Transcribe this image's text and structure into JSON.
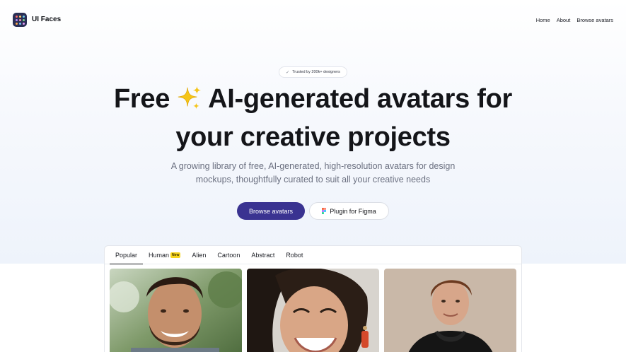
{
  "brand": {
    "name": "UI Faces",
    "logo_dot_colors": [
      "#ff6b6b",
      "#ffd166",
      "#6bcBef",
      "#b388ff",
      "#f78fb3",
      "#7bd88f",
      "#ffa94d",
      "#74c0fc",
      "#e599f7"
    ]
  },
  "nav": {
    "items": [
      "Home",
      "About",
      "Browse avatars"
    ]
  },
  "hero": {
    "trust_badge": "Trusted by 200k+ designers",
    "headline_part1": "Free",
    "headline_part2": "AI-generated avatars for",
    "headline_line2": "your creative projects",
    "subtitle": "A growing library of free, AI-generated, high-resolution avatars for design mockups, thoughtfully curated to suit all your creative needs",
    "primary_button": "Browse avatars",
    "secondary_button": "Plugin for Figma"
  },
  "tabs": {
    "items": [
      {
        "label": "Popular",
        "active": true
      },
      {
        "label": "Human",
        "badge": "New"
      },
      {
        "label": "Alien"
      },
      {
        "label": "Cartoon"
      },
      {
        "label": "Abstract"
      },
      {
        "label": "Robot"
      }
    ]
  },
  "colors": {
    "accent": "#3a3391",
    "badge": "#f7d51d",
    "sparkle": "#f5c518"
  },
  "avatars": [
    {
      "icon": "smiling-man-beard-photo"
    },
    {
      "icon": "laughing-woman-photo"
    },
    {
      "icon": "young-man-hoodie-photo"
    }
  ]
}
